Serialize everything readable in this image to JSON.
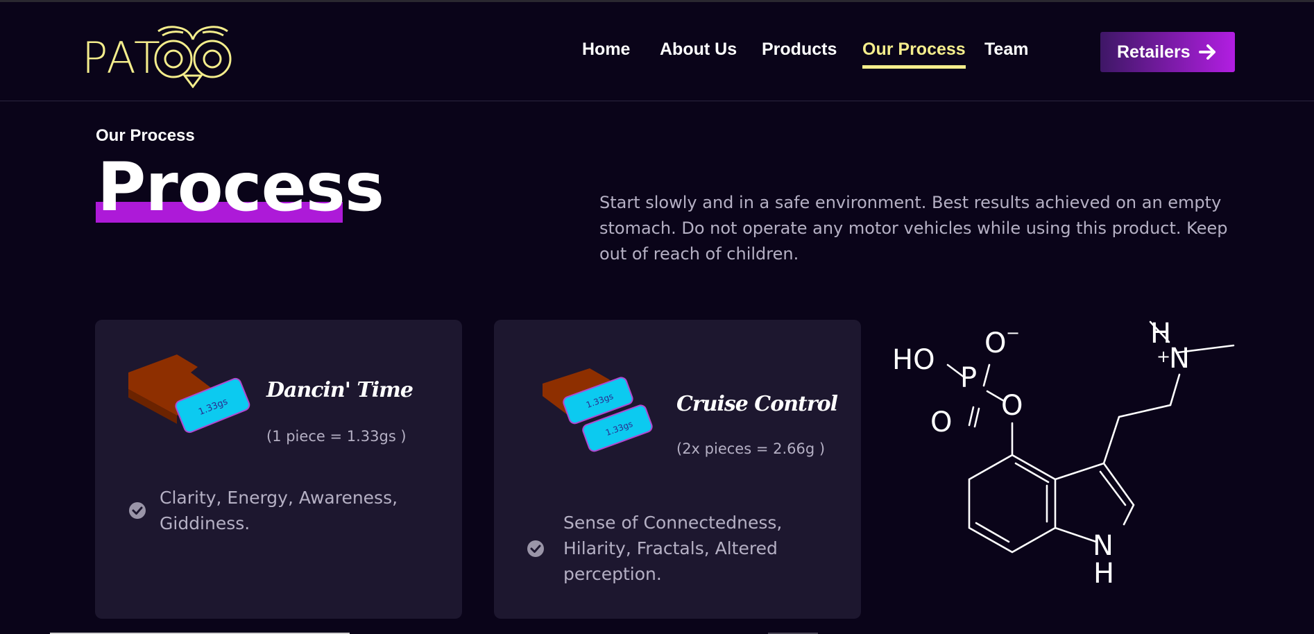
{
  "brand": {
    "logo_text": "PAT"
  },
  "nav": {
    "items": [
      {
        "label": "Home",
        "active": false
      },
      {
        "label": "About Us",
        "active": false
      },
      {
        "label": "Products",
        "active": false
      },
      {
        "label": "Our Process",
        "active": true
      },
      {
        "label": "Team",
        "active": false
      }
    ],
    "cta_label": "Retailers"
  },
  "hero": {
    "eyebrow": "Our Process",
    "title": "Process",
    "intro": "Start slowly and in a safe environment. Best results achieved on an empty stomach. Do not operate any motor vehicles while using this product. Keep out of reach of children."
  },
  "cards": [
    {
      "title": "Dancin' Time",
      "dose": "(1 piece  = 1.33gs )",
      "chip_label": "1.33gs",
      "effects": "Clarity, Energy, Awareness, Giddiness."
    },
    {
      "title": "Cruise Control",
      "dose": "(2x pieces = 2.66g )",
      "chip_label": "1.33gs",
      "effects": "Sense of Connectedness, Hilarity, Fractals, Altered perception."
    }
  ],
  "molecule": {
    "labels": {
      "ho": "HO",
      "o_minus": "O",
      "minus": "−",
      "p": "P",
      "o_ester": "O",
      "o_double": "O",
      "h_top": "H",
      "plus": "+",
      "n_plus": "N",
      "n_ring": "N",
      "h_ring": "H"
    }
  },
  "colors": {
    "background": "#0a0419",
    "accent_yellow": "#f4ed8c",
    "accent_purple": "#ad1ad8",
    "card_bg": "#1d172f",
    "body_text": "#b5b0c4",
    "chip_cyan": "#0ccaf0",
    "chocolate": "#8e2f00"
  },
  "icons": [
    "owl-eyes-icon",
    "arrow-right-icon",
    "check-circle-icon",
    "chocolate-bar-icon",
    "molecule-diagram"
  ]
}
